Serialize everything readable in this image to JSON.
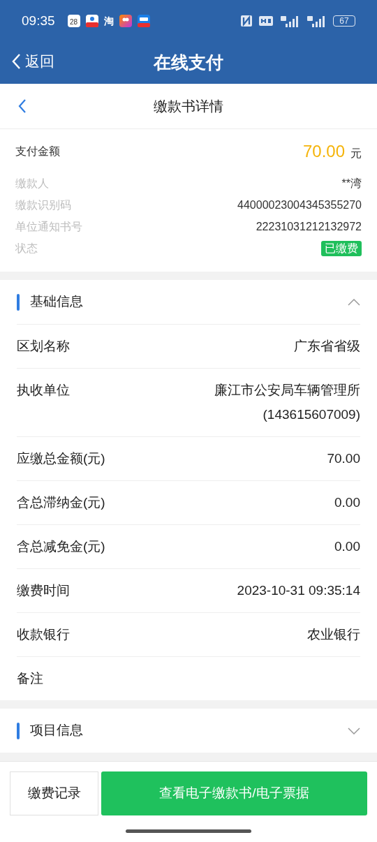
{
  "status_bar": {
    "time": "09:35",
    "calendar_day": "28",
    "taobao_glyph": "淘",
    "battery": "67"
  },
  "nav_bar": {
    "back_label": "返回",
    "title": "在线支付"
  },
  "sub_header": {
    "title": "缴款书详情"
  },
  "summary": {
    "amount_label": "支付金额",
    "amount": "70.00",
    "currency": "元",
    "fields": [
      {
        "label": "缴款人",
        "value": "**湾",
        "kind": "text"
      },
      {
        "label": "缴款识别码",
        "value": "44000023004345355270",
        "kind": "text"
      },
      {
        "label": "单位通知书号",
        "value": "22231031212132972",
        "kind": "text"
      },
      {
        "label": "状态",
        "value": "已缴费",
        "kind": "badge"
      }
    ]
  },
  "sections": [
    {
      "title": "基础信息",
      "expanded": true,
      "rows": [
        {
          "label": "区划名称",
          "value": "广东省省级"
        },
        {
          "label": "执收单位",
          "value": "廉江市公安局车辆管理所",
          "value_line2": "(143615607009)"
        },
        {
          "label": "应缴总金额(元)",
          "value": "70.00"
        },
        {
          "label": "含总滞纳金(元)",
          "value": "0.00"
        },
        {
          "label": "含总减免金(元)",
          "value": "0.00"
        },
        {
          "label": "缴费时间",
          "value": "2023-10-31 09:35:14"
        },
        {
          "label": "收款银行",
          "value": "农业银行"
        },
        {
          "label": "备注"
        }
      ]
    },
    {
      "title": "项目信息",
      "expanded": false
    }
  ],
  "buttons": {
    "secondary": "缴费记录",
    "primary": "查看电子缴款书/电子票据"
  }
}
